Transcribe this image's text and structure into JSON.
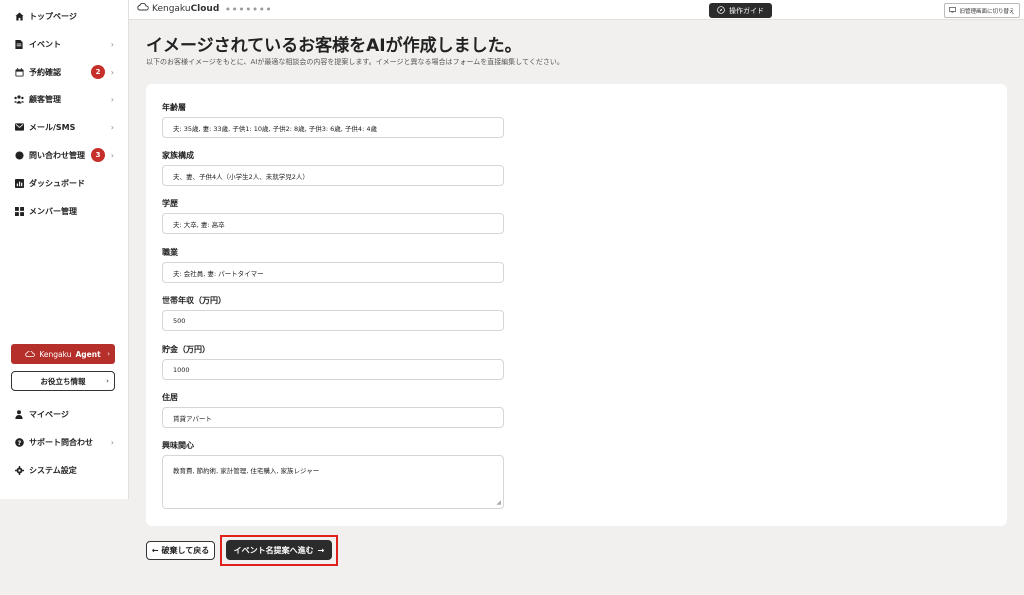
{
  "sidebar": {
    "items": [
      {
        "label": "トップページ",
        "icon": "home-icon"
      },
      {
        "label": "イベント",
        "icon": "document-icon",
        "chevron": "›"
      },
      {
        "label": "予約確認",
        "icon": "calendar-icon",
        "badge": "2",
        "chevron": "›"
      },
      {
        "label": "顧客管理",
        "icon": "people-icon",
        "chevron": "›"
      },
      {
        "label": "メール/SMS",
        "icon": "mail-icon",
        "chevron": "›"
      },
      {
        "label": "問い合わせ管理",
        "icon": "chat-icon",
        "badge": "3",
        "chevron": "›"
      },
      {
        "label": "ダッシュボード",
        "icon": "chart-icon"
      },
      {
        "label": "メンバー管理",
        "icon": "grid-icon"
      }
    ],
    "agent_button": {
      "logo": "Kengaku",
      "label": "Agent",
      "chevron": "›"
    },
    "info_button": {
      "label": "お役立ち情報",
      "chevron": "›"
    },
    "bottom_items": [
      {
        "label": "マイページ",
        "icon": "user-icon"
      },
      {
        "label": "サポート問合わせ",
        "icon": "help-icon",
        "chevron": "›"
      },
      {
        "label": "システム設定",
        "icon": "gear-icon"
      }
    ]
  },
  "topbar": {
    "logo_light": "Kengaku",
    "logo_bold": "Cloud",
    "guide_label": "操作ガイド",
    "switch_label": "旧管理画面に切り替え"
  },
  "main": {
    "title": "イメージされているお客様をAIが作成しました。",
    "description": "以下のお客様イメージをもとに、AIが最適な相談会の内容を提案します。イメージと異なる場合はフォームを直接編集してください。",
    "fields": [
      {
        "label": "年齢層",
        "value": "夫: 35歳, 妻: 33歳, 子供1: 10歳, 子供2: 8歳, 子供3: 6歳, 子供4: 4歳"
      },
      {
        "label": "家族構成",
        "value": "夫、妻、子供4人（小学生2人、未就学児2人）"
      },
      {
        "label": "学歴",
        "value": "夫: 大卒, 妻: 高卒"
      },
      {
        "label": "職業",
        "value": "夫: 会社員, 妻: パートタイマー"
      },
      {
        "label": "世帯年収（万円）",
        "value": "500"
      },
      {
        "label": "貯金（万円）",
        "value": "1000"
      },
      {
        "label": "住居",
        "value": "賃貸アパート"
      },
      {
        "label": "興味関心",
        "value": "教育費, 節約術, 家計管理, 住宅購入, 家族レジャー"
      }
    ],
    "back_button": "破棄して戻る",
    "back_arrow": "←",
    "next_button": "イベント名提案へ進む",
    "next_arrow": "→"
  },
  "colors": {
    "accent": "#b5302a",
    "badge": "#c62f2a",
    "highlight": "#e0201a",
    "dark": "#2b2b2b"
  }
}
